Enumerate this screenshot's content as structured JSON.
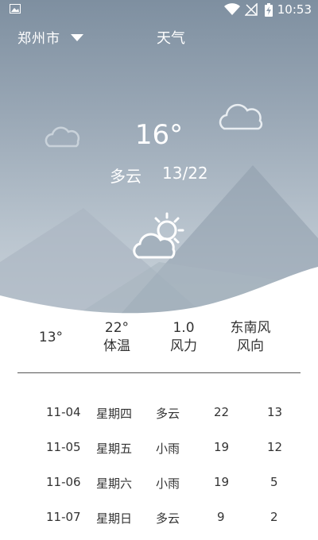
{
  "status_bar": {
    "time": "10:53"
  },
  "header": {
    "city": "郑州市",
    "title": "天气"
  },
  "current": {
    "temperature": "16°",
    "condition": "多云",
    "range": "13/22"
  },
  "stats": [
    {
      "value": "13°",
      "label": ""
    },
    {
      "value": "22°",
      "label": "体温"
    },
    {
      "value": "1.0",
      "label": "风力"
    },
    {
      "value": "东南风",
      "label": "风向"
    }
  ],
  "forecast": [
    {
      "date": "11-04",
      "weekday": "星期四",
      "weather": "多云",
      "high": "22",
      "low": "13"
    },
    {
      "date": "11-05",
      "weekday": "星期五",
      "weather": "小雨",
      "high": "19",
      "low": "12"
    },
    {
      "date": "11-06",
      "weekday": "星期六",
      "weather": "小雨",
      "high": "19",
      "low": "5"
    },
    {
      "date": "11-07",
      "weekday": "星期日",
      "weather": "多云",
      "high": "9",
      "low": "2"
    }
  ],
  "colors": {
    "sky_top": "#7e8fa0",
    "sky_bottom": "#cfd7de",
    "text": "#333333"
  },
  "icons": [
    "image-icon",
    "wifi-icon",
    "signal-icon",
    "battery-icon",
    "dropdown-caret-icon",
    "cloud-icon",
    "partly-cloudy-icon"
  ]
}
